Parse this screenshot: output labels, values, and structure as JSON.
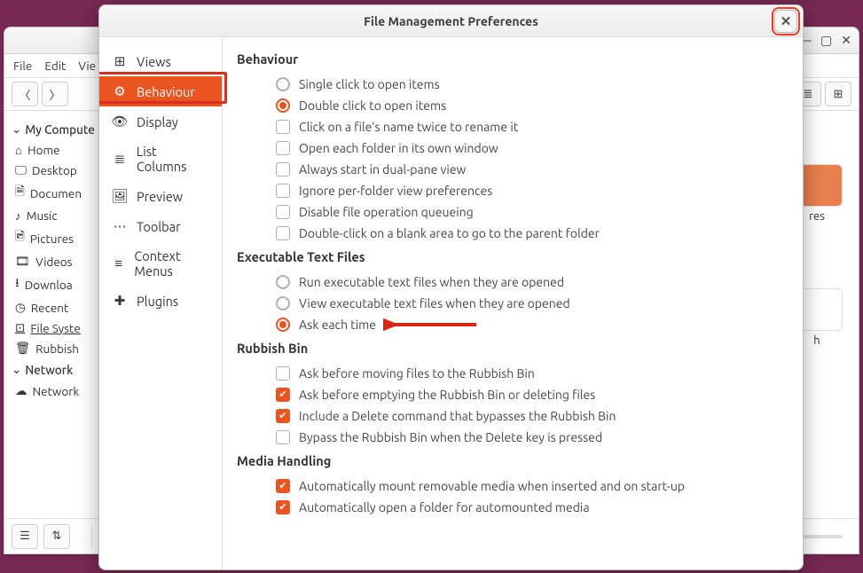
{
  "bg": {
    "menus": [
      "File",
      "Edit",
      "Vie"
    ],
    "sidebar": {
      "computer_header": "My Compute",
      "items": [
        "Home",
        "Desktop",
        "Documen",
        "Music",
        "Pictures",
        "Videos",
        "Downloa",
        "Recent",
        "File Syste",
        "Rubbish "
      ],
      "network_header": "Network",
      "network_items": [
        "Network"
      ]
    },
    "folders": [
      "res",
      "h"
    ],
    "statusbar": {
      "left_icons": [
        "☰",
        "⇅"
      ]
    }
  },
  "dialog": {
    "title": "File Management Preferences",
    "nav": [
      {
        "icon": "⊞",
        "label": "Views"
      },
      {
        "icon": "⚙",
        "label": "Behaviour",
        "active": true
      },
      {
        "icon": "👁",
        "label": "Display"
      },
      {
        "icon": "≣",
        "label": "List Columns"
      },
      {
        "icon": "🖼",
        "label": "Preview"
      },
      {
        "icon": "⋯",
        "label": "Toolbar"
      },
      {
        "icon": "≡",
        "label": "Context Menus"
      },
      {
        "icon": "✚",
        "label": "Plugins"
      }
    ],
    "sections": {
      "behaviour": {
        "title": "Behaviour",
        "radio_group": [
          {
            "label": "Single click to open items",
            "checked": false
          },
          {
            "label": "Double click to open items",
            "checked": true
          }
        ],
        "checks": [
          {
            "label": "Click on a file's name twice to rename it",
            "checked": false
          },
          {
            "label": "Open each folder in its own window",
            "checked": false
          },
          {
            "label": "Always start in dual-pane view",
            "checked": false
          },
          {
            "label": "Ignore per-folder view preferences",
            "checked": false
          },
          {
            "label": "Disable file operation queueing",
            "checked": false
          },
          {
            "label": "Double-click on a blank area to go to the parent folder",
            "checked": false
          }
        ]
      },
      "exec": {
        "title": "Executable Text Files",
        "radio_group": [
          {
            "label": "Run executable text files when they are opened",
            "checked": false
          },
          {
            "label": "View executable text files when they are opened",
            "checked": false
          },
          {
            "label": "Ask each time",
            "checked": true
          }
        ]
      },
      "rubbish": {
        "title": "Rubbish Bin",
        "checks": [
          {
            "label": "Ask before moving files to the Rubbish Bin",
            "checked": false
          },
          {
            "label": "Ask before emptying the Rubbish Bin or deleting files",
            "checked": true
          },
          {
            "label": "Include a Delete command that bypasses the Rubbish Bin",
            "checked": true
          },
          {
            "label": "Bypass the Rubbish Bin when the Delete key is pressed",
            "checked": false
          }
        ]
      },
      "media": {
        "title": "Media Handling",
        "checks": [
          {
            "label": "Automatically mount removable media when inserted and on start-up",
            "checked": true
          },
          {
            "label": "Automatically open a folder for automounted media",
            "checked": true
          }
        ]
      }
    }
  }
}
